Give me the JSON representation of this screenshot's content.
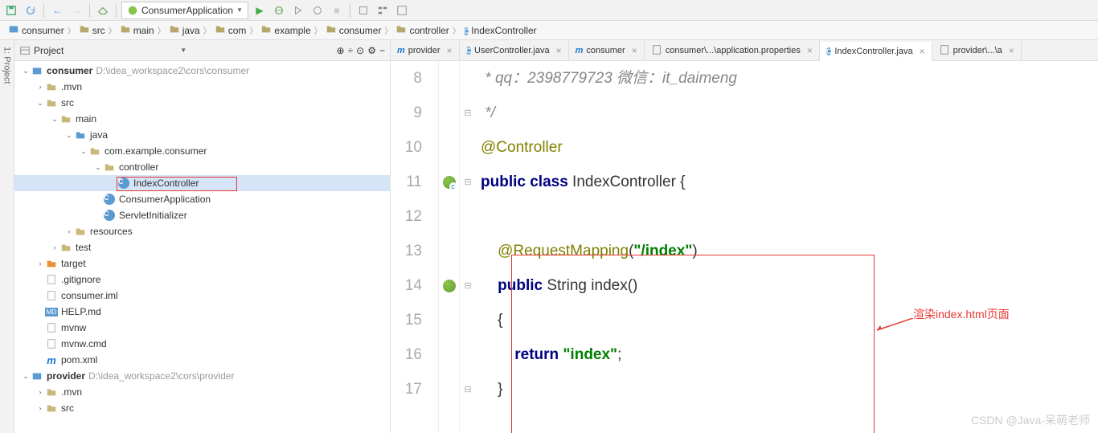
{
  "toolbar": {
    "run_config": "ConsumerApplication"
  },
  "breadcrumb": [
    {
      "icon": "module",
      "label": "consumer"
    },
    {
      "icon": "folder",
      "label": "src"
    },
    {
      "icon": "folder",
      "label": "main"
    },
    {
      "icon": "folder",
      "label": "java"
    },
    {
      "icon": "folder",
      "label": "com"
    },
    {
      "icon": "folder",
      "label": "example"
    },
    {
      "icon": "folder",
      "label": "consumer"
    },
    {
      "icon": "folder",
      "label": "controller"
    },
    {
      "icon": "class",
      "label": "IndexController"
    }
  ],
  "project": {
    "title": "Project",
    "tree": [
      {
        "depth": 0,
        "arrow": "v",
        "icon": "module",
        "label": "consumer",
        "dim": "D:\\idea_workspace2\\cors\\consumer"
      },
      {
        "depth": 1,
        "arrow": ">",
        "icon": "folder",
        "label": ".mvn"
      },
      {
        "depth": 1,
        "arrow": "v",
        "icon": "folder",
        "label": "src"
      },
      {
        "depth": 2,
        "arrow": "v",
        "icon": "folder",
        "label": "main"
      },
      {
        "depth": 3,
        "arrow": "v",
        "icon": "folder-blue",
        "label": "java"
      },
      {
        "depth": 4,
        "arrow": "v",
        "icon": "package",
        "label": "com.example.consumer"
      },
      {
        "depth": 5,
        "arrow": "v",
        "icon": "package",
        "label": "controller"
      },
      {
        "depth": 6,
        "arrow": "",
        "icon": "class",
        "label": "IndexController",
        "selected": true
      },
      {
        "depth": 5,
        "arrow": "",
        "icon": "class",
        "label": "ConsumerApplication"
      },
      {
        "depth": 5,
        "arrow": "",
        "icon": "class",
        "label": "ServletInitializer"
      },
      {
        "depth": 3,
        "arrow": ">",
        "icon": "folder",
        "label": "resources"
      },
      {
        "depth": 2,
        "arrow": ">",
        "icon": "folder",
        "label": "test"
      },
      {
        "depth": 1,
        "arrow": ">",
        "icon": "folder-orange",
        "label": "target"
      },
      {
        "depth": 1,
        "arrow": "",
        "icon": "file",
        "label": ".gitignore"
      },
      {
        "depth": 1,
        "arrow": "",
        "icon": "file",
        "label": "consumer.iml"
      },
      {
        "depth": 1,
        "arrow": "",
        "icon": "md",
        "label": "HELP.md"
      },
      {
        "depth": 1,
        "arrow": "",
        "icon": "file",
        "label": "mvnw"
      },
      {
        "depth": 1,
        "arrow": "",
        "icon": "file",
        "label": "mvnw.cmd"
      },
      {
        "depth": 1,
        "arrow": "",
        "icon": "maven",
        "label": "pom.xml"
      },
      {
        "depth": 0,
        "arrow": "v",
        "icon": "module",
        "label": "provider",
        "dim": "D:\\idea_workspace2\\cors\\provider"
      },
      {
        "depth": 1,
        "arrow": ">",
        "icon": "folder",
        "label": ".mvn"
      },
      {
        "depth": 1,
        "arrow": ">",
        "icon": "folder",
        "label": "src"
      }
    ]
  },
  "tabs": [
    {
      "icon": "maven",
      "label": "provider"
    },
    {
      "icon": "class",
      "label": "UserController.java"
    },
    {
      "icon": "maven",
      "label": "consumer"
    },
    {
      "icon": "props",
      "label": "consumer\\...\\application.properties"
    },
    {
      "icon": "class",
      "label": "IndexController.java",
      "active": true
    },
    {
      "icon": "props",
      "label": "provider\\...\\a"
    }
  ],
  "code": {
    "lines": [
      8,
      9,
      10,
      11,
      12,
      13,
      14,
      15,
      16,
      17
    ],
    "l8": " * qq：2398779723 微信：it_daimeng",
    "l9": " */",
    "l10a": "@Controller",
    "l11k": "public class ",
    "l11n": "IndexController {",
    "l13a": "@RequestMapping",
    "l13p": "(",
    "l13s": "\"/index\"",
    "l13p2": ")",
    "l14k": "public ",
    "l14t": "String ",
    "l14n": "index()",
    "l15": "{",
    "l16k": "return ",
    "l16s": "\"index\"",
    "l16e": ";",
    "l17": "}"
  },
  "annotation": "渲染index.html页面",
  "watermark": "CSDN @Java-呆萌老师",
  "side_label": "1: Project"
}
